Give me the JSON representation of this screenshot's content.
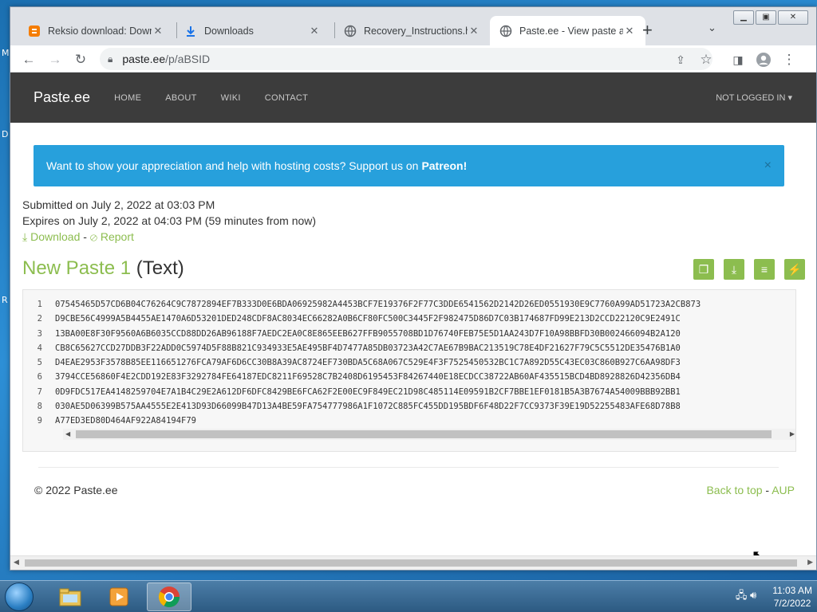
{
  "desktop": {
    "edge_letters": [
      "M",
      "D",
      "R"
    ]
  },
  "browser": {
    "tabs": [
      {
        "title": "Reksio download: Down",
        "icon": "blogger-icon"
      },
      {
        "title": "Downloads",
        "icon": "download-icon"
      },
      {
        "title": "Recovery_Instructions.ht",
        "icon": "globe-icon"
      },
      {
        "title": "Paste.ee - View paste aB",
        "icon": "globe-icon",
        "active": true
      }
    ],
    "address": {
      "domain": "paste.ee",
      "path": "/p/aBSID"
    }
  },
  "site": {
    "brand": "Paste.ee",
    "nav": [
      "HOME",
      "ABOUT",
      "WIKI",
      "CONTACT"
    ],
    "account": "NOT LOGGED IN",
    "alert": {
      "text": "Want to show your appreciation and help with hosting costs? Support us on",
      "link": "Patreon",
      "suffix": "!",
      "close": "×"
    },
    "submitted": "Submitted on July 2, 2022 at 03:03 PM",
    "expires": "Expires on July 2, 2022 at 04:03 PM (59 minutes from now)",
    "download": "Download",
    "separator": " - ",
    "report": "Report",
    "paste_name": "New Paste 1",
    "paste_kind": "(Text)",
    "lines": [
      "07545465D57CD6B04C76264C9C7872894EF7B333D0E6BDA06925982A4453BCF7E19376F2F77C3DDE6541562D2142D26ED0551930E9C7760A99AD51723A2CB873",
      "D9CBE56C4999A5B4455AE1470A6D53201DED248CDF8AC8034EC66282A0B6CF80FC500C3445F2F982475D86D7C03B174687FD99E213D2CCD22120C9E2491C",
      "13BA00E8F30F9560A6B6035CCD88DD26AB96188F7AEDC2EA0C8E865EEB627FFB9055708BD1D76740FEB75E5D1AA243D7F10A98BBFD30B002466094B2A120",
      "CB8C65627CCD27DDB3F22ADD0C5974D5F88B821C934933E5AE495BF4D7477A85DB03723A42C7AE67B9BAC213519C78E4DF21627F79C5C5512DE35476B1A0",
      "D4EAE2953F3578B85EE116651276FCA79AF6D6CC30B8A39AC8724EF730BDA5C68A067C529E4F3F7525450532BC1C7A892D55C43EC03C860B927C6AA98DF3",
      "3794CCE56860F4E2CDD192E83F3292784FE64187EDC8211F69528C7B2408D6195453F84267440E18ECDCC38722AB60AF435515BCD4BD8928826D42356DB4",
      "0D9FDC517EA4148259704E7A1B4C29E2A612DF6DFC8429BE6FCA62F2E00EC9F849EC21D98C485114E09591B2CF7BBE1EF0181B5A3B7674A54009BBB92BB1",
      "030AE5D06399B575AA4555E2E413D93D66099B47D13A4BE59FA754777986A1F1072C885FC455DD195BDF6F48D22F7CC9373F39E19D52255483AFE68D78B8",
      "A77ED3ED80D464AF922A84194F79"
    ],
    "copyright": "© 2022 Paste.ee",
    "back_to_top": "Back to top",
    "aup": "AUP"
  },
  "taskbar": {
    "time": "11:03 AM",
    "date": "7/2/2022"
  }
}
